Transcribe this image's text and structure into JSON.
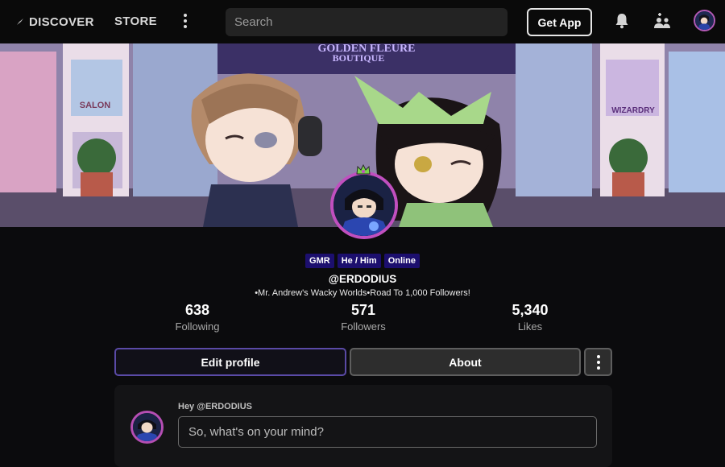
{
  "nav": {
    "discover_label": "DISCOVER",
    "store_label": "STORE",
    "search_placeholder": "Search",
    "get_app_label": "Get App"
  },
  "banner": {
    "sign_main": "GOLDEN FLEURE",
    "sign_sub": "BOUTIQUE",
    "sign_salon": "SALON",
    "sign_wizardry": "WIZARDRY"
  },
  "profile": {
    "badges": [
      "GMR",
      "He / Him",
      "Online"
    ],
    "username": "@ERDODIUS",
    "bio": "•Mr. Andrew's Wacky Worlds•Road To 1,000 Followers!",
    "accent_color": "#c04fbf",
    "badge_color": "#1c0f6e"
  },
  "stats": [
    {
      "value": "638",
      "label": "Following"
    },
    {
      "value": "571",
      "label": "Followers"
    },
    {
      "value": "5,340",
      "label": "Likes"
    }
  ],
  "actions": {
    "edit_label": "Edit profile",
    "about_label": "About"
  },
  "composer": {
    "greeting": "Hey @ERDODIUS",
    "placeholder": "So, what's on your mind?"
  },
  "icons": [
    "compass-icon",
    "more-vertical-icon",
    "bell-icon",
    "add-friend-icon",
    "avatar"
  ]
}
